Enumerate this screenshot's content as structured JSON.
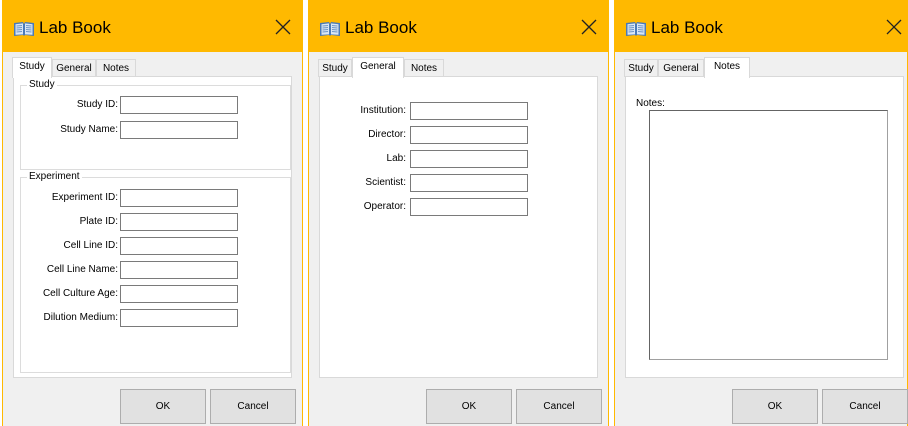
{
  "app": {
    "title": "Lab Book",
    "accent_color": "#ffb900",
    "title_icon": "book-icon",
    "close_icon": "close-icon"
  },
  "tabs": [
    "Study",
    "General",
    "Notes"
  ],
  "study": {
    "group_label": "Study",
    "fields": [
      {
        "label": "Study ID:",
        "value": ""
      },
      {
        "label": "Study Name:",
        "value": ""
      }
    ]
  },
  "experiment": {
    "group_label": "Experiment",
    "fields": [
      {
        "label": "Experiment ID:",
        "value": ""
      },
      {
        "label": "Plate ID:",
        "value": ""
      },
      {
        "label": "Cell Line ID:",
        "value": ""
      },
      {
        "label": "Cell Line Name:",
        "value": ""
      },
      {
        "label": "Cell Culture Age:",
        "value": ""
      },
      {
        "label": "Dilution Medium:",
        "value": ""
      }
    ]
  },
  "general": {
    "fields": [
      {
        "label": "Institution:",
        "value": ""
      },
      {
        "label": "Director:",
        "value": ""
      },
      {
        "label": "Lab:",
        "value": ""
      },
      {
        "label": "Scientist:",
        "value": ""
      },
      {
        "label": "Operator:",
        "value": ""
      }
    ]
  },
  "notes": {
    "label": "Notes:",
    "value": ""
  },
  "buttons": {
    "ok": "OK",
    "cancel": "Cancel"
  }
}
